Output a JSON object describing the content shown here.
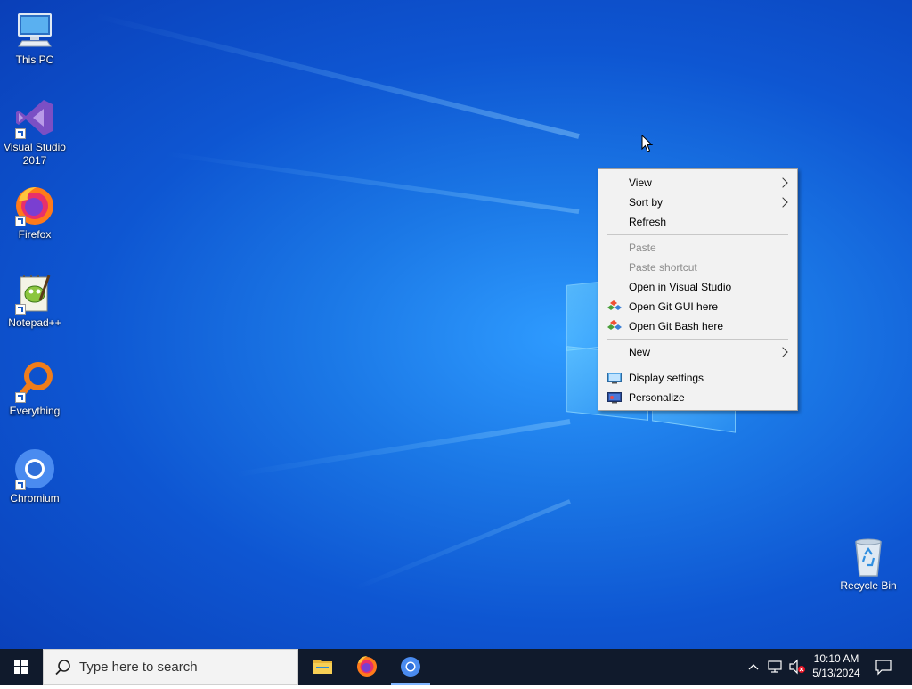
{
  "desktop_icons": [
    {
      "label": "This PC",
      "icon": "computer-icon",
      "shortcut": false
    },
    {
      "label": "Visual Studio\n2017",
      "label_line1": "Visual Studio",
      "label_line2": "2017",
      "icon": "visual-studio-icon",
      "shortcut": true
    },
    {
      "label": "Firefox",
      "icon": "firefox-icon",
      "shortcut": true
    },
    {
      "label": "Notepad++",
      "icon": "notepad-plus-plus-icon",
      "shortcut": true
    },
    {
      "label": "Everything",
      "icon": "everything-search-icon",
      "shortcut": true
    },
    {
      "label": "Chromium",
      "icon": "chromium-icon",
      "shortcut": true
    }
  ],
  "recycle_bin": {
    "label": "Recycle Bin",
    "icon": "recycle-bin-icon"
  },
  "context_menu": {
    "items": [
      {
        "label": "View",
        "submenu": true
      },
      {
        "label": "Sort by",
        "submenu": true
      },
      {
        "label": "Refresh"
      },
      {
        "label": "Paste",
        "disabled": true
      },
      {
        "label": "Paste shortcut",
        "disabled": true
      },
      {
        "label": "Open in Visual Studio"
      },
      {
        "label": "Open Git GUI here",
        "icon": "git-icon"
      },
      {
        "label": "Open Git Bash here",
        "icon": "git-icon"
      },
      {
        "label": "New",
        "submenu": true
      },
      {
        "label": "Display settings",
        "icon": "display-icon"
      },
      {
        "label": "Personalize",
        "icon": "personalize-icon"
      }
    ]
  },
  "taskbar": {
    "search_placeholder": "Type here to search",
    "apps": [
      {
        "name": "file-explorer",
        "icon": "folder-icon"
      },
      {
        "name": "firefox",
        "icon": "firefox-icon"
      },
      {
        "name": "chromium",
        "icon": "chromium-icon",
        "active": true
      }
    ],
    "clock_time": "10:10 AM",
    "clock_date": "5/13/2024"
  },
  "colors": {
    "desktop_blue": "#0e56d2",
    "taskbar": "#101a2c",
    "menu_bg": "#f2f2f2",
    "disabled_text": "#8d8d8d"
  }
}
